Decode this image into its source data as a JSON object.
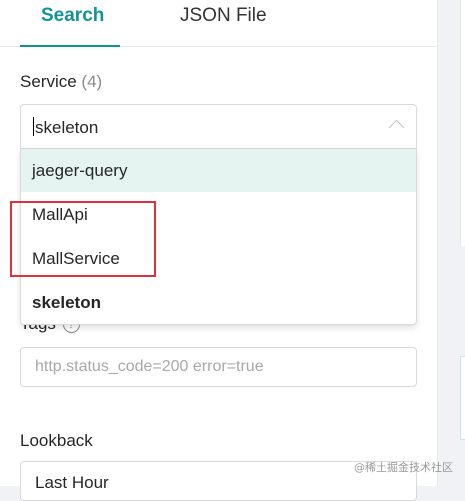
{
  "tabs": [
    {
      "label": "Search",
      "active": true
    },
    {
      "label": "JSON File",
      "active": false
    }
  ],
  "service": {
    "label": "Service",
    "count": "(4)",
    "input_value": "skeleton",
    "options": [
      {
        "label": "jaeger-query",
        "highlighted": true
      },
      {
        "label": "MallApi"
      },
      {
        "label": "MallService"
      },
      {
        "label": "skeleton",
        "bold": true
      }
    ]
  },
  "tags": {
    "label": "Tags",
    "help_glyph": "?",
    "placeholder": "http.status_code=200 error=true"
  },
  "lookback": {
    "label": "Lookback",
    "value": "Last Hour"
  },
  "annotation": {
    "color": "#e0303b"
  },
  "colors": {
    "accent": "#11939a",
    "option_hover": "#e6f4f1"
  },
  "watermark": "@稀土掘金技术社区"
}
